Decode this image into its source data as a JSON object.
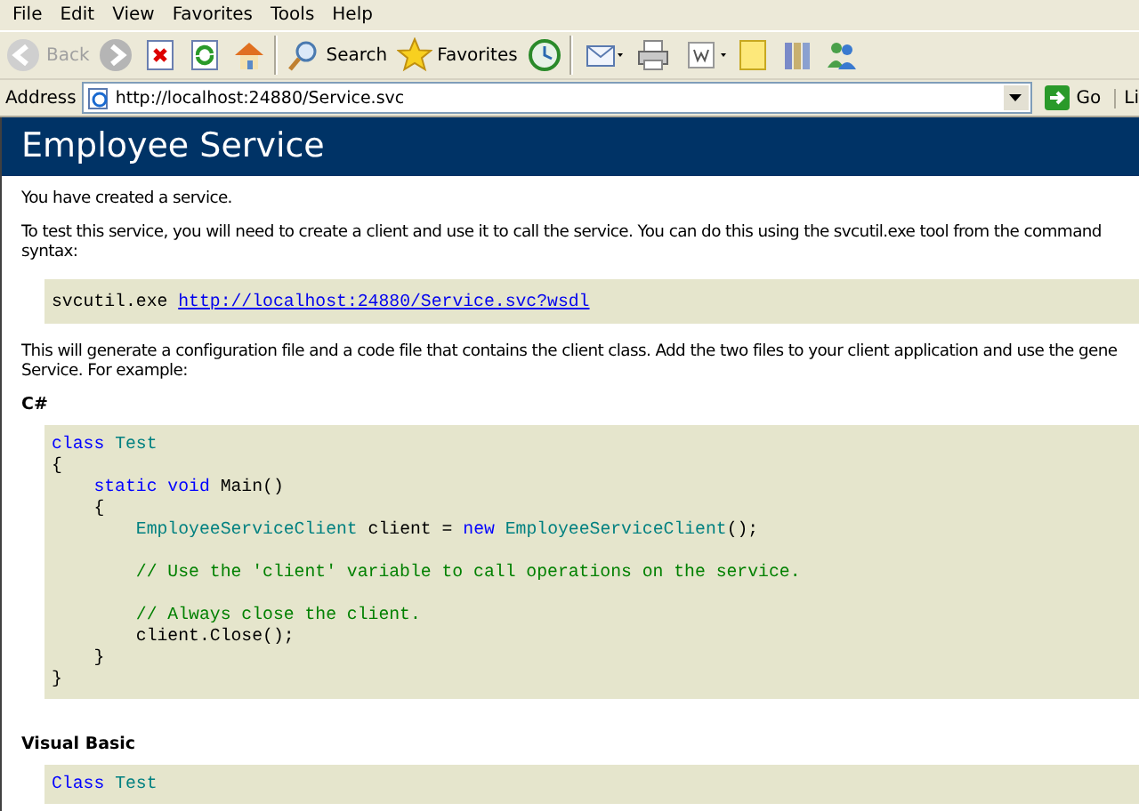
{
  "menu": [
    "File",
    "Edit",
    "View",
    "Favorites",
    "Tools",
    "Help"
  ],
  "toolbar": [
    {
      "kind": "back",
      "label": "Back",
      "disabled": true
    },
    {
      "kind": "forward",
      "disabled": false
    },
    {
      "kind": "stop"
    },
    {
      "kind": "refresh"
    },
    {
      "kind": "home"
    },
    {
      "kind": "search",
      "label": "Search"
    },
    {
      "kind": "favorites",
      "label": "Favorites"
    },
    {
      "kind": "history"
    },
    {
      "kind": "mail"
    },
    {
      "kind": "print"
    },
    {
      "kind": "edit"
    },
    {
      "kind": "note"
    },
    {
      "kind": "research"
    },
    {
      "kind": "messenger"
    }
  ],
  "address": {
    "label": "Address",
    "value": "http://localhost:24880/Service.svc",
    "go": "Go",
    "links": "Li"
  },
  "page": {
    "title": "Employee Service",
    "intro": "You have created a service.",
    "test_lines": [
      "To test this service, you will need to create a client and use it to call the service. You can do this using the svcutil.exe tool from the command",
      "syntax:"
    ],
    "command": {
      "text": "svcutil.exe",
      "link": "http://localhost:24880/Service.svc?wsdl"
    },
    "generate_lines": [
      "This will generate a configuration file and a code file that contains the client class. Add the two files to your client application and use the gene",
      "Service. For example:"
    ],
    "samples": [
      {
        "heading": "C#",
        "lines": [
          {
            "tokens": [
              {
                "kind": "keyword",
                "text": "class"
              },
              {
                "kind": "type",
                "text": "Test"
              }
            ]
          },
          {
            "tokens": [
              {
                "kind": "plain",
                "text": "{"
              }
            ]
          },
          {
            "tokens": [
              {
                "kind": "plain",
                "text": "}"
              }
            ],
            "children": [
              {
                "tokens": [
                  {
                    "kind": "keyword",
                    "text": "static void"
                  },
                  {
                    "kind": "plain",
                    "text": "Main()"
                  }
                ]
              },
              {
                "tokens": [
                  {
                    "kind": "plain",
                    "text": "{"
                  }
                ]
              },
              {
                "tokens": [
                  {
                    "kind": "plain",
                    "text": "}"
                  }
                ],
                "children": [
                  {
                    "tokens": [
                      {
                        "kind": "type",
                        "text": "EmployeeServiceClient"
                      },
                      {
                        "kind": "plain",
                        "text": "client ="
                      },
                      {
                        "kind": "keyword",
                        "text": "new"
                      },
                      {
                        "kind": "type",
                        "text": "EmployeeServiceClient"
                      },
                      {
                        "kind": "punct",
                        "text": "();"
                      }
                    ]
                  },
                  {
                    "spaced": true,
                    "tokens": [
                      {
                        "kind": "comment",
                        "text": "// Use the 'client' variable to call operations on the service."
                      }
                    ]
                  },
                  {
                    "spaced": true,
                    "tokens": [
                      {
                        "kind": "comment",
                        "text": "// Always close the client."
                      }
                    ]
                  },
                  {
                    "tokens": [
                      {
                        "kind": "plain",
                        "text": "client.Close();"
                      }
                    ]
                  }
                ]
              }
            ]
          }
        ]
      },
      {
        "heading": "Visual Basic",
        "lines": [
          {
            "tokens": [
              {
                "kind": "keyword",
                "text": "Class"
              },
              {
                "kind": "type",
                "text": "Test"
              }
            ]
          }
        ]
      }
    ]
  }
}
